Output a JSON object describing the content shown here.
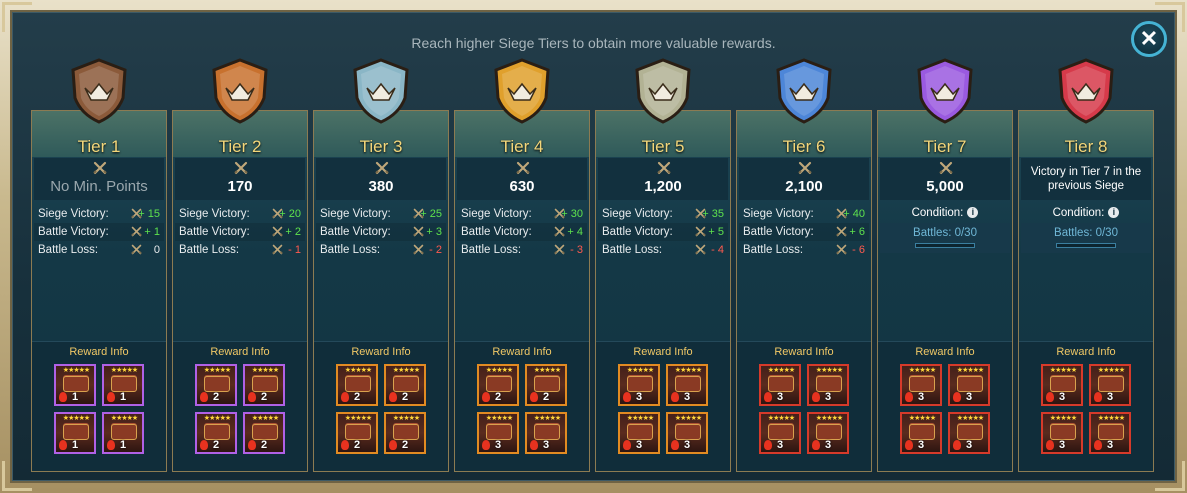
{
  "header": {
    "subtitle": "Reach higher Siege Tiers to obtain more valuable rewards."
  },
  "labels": {
    "siege_victory": "Siege Victory:",
    "battle_victory": "Battle Victory:",
    "battle_loss": "Battle Loss:",
    "reward_info": "Reward Info",
    "condition": "Condition:",
    "info_icon": "i",
    "close_icon": "✕"
  },
  "tiers": [
    {
      "name": "Tier 1",
      "points": "No Min. Points",
      "siege": "+ 15",
      "victory": "+ 1",
      "loss": "0",
      "lossType": "zero",
      "chestColor": "purple",
      "qty": [
        "1",
        "1",
        "1",
        "1"
      ],
      "shieldColor": "#8b5a3a"
    },
    {
      "name": "Tier 2",
      "points": "170",
      "siege": "+ 20",
      "victory": "+ 2",
      "loss": "- 1",
      "lossType": "neg",
      "chestColor": "purple",
      "qty": [
        "2",
        "2",
        "2",
        "2"
      ],
      "shieldColor": "#c8712e"
    },
    {
      "name": "Tier 3",
      "points": "380",
      "siege": "+ 25",
      "victory": "+ 3",
      "loss": "- 2",
      "lossType": "neg",
      "chestColor": "orange",
      "qty": [
        "2",
        "2",
        "2",
        "2"
      ],
      "shieldColor": "#8ab6c6"
    },
    {
      "name": "Tier 4",
      "points": "630",
      "siege": "+ 30",
      "victory": "+ 4",
      "loss": "- 3",
      "lossType": "neg",
      "chestColor": "orange",
      "qty": [
        "2",
        "2",
        "3",
        "3"
      ],
      "shieldColor": "#e0a02c"
    },
    {
      "name": "Tier 5",
      "points": "1,200",
      "siege": "+ 35",
      "victory": "+ 5",
      "loss": "- 4",
      "lossType": "neg",
      "chestColor": "orange",
      "qty": [
        "3",
        "3",
        "3",
        "3"
      ],
      "shieldColor": "#b2b294"
    },
    {
      "name": "Tier 6",
      "points": "2,100",
      "siege": "+ 40",
      "victory": "+ 6",
      "loss": "- 6",
      "lossType": "neg",
      "chestColor": "red",
      "qty": [
        "3",
        "3",
        "3",
        "3"
      ],
      "shieldColor": "#4d86d8"
    },
    {
      "name": "Tier 7",
      "points": "5,000",
      "condition": "Condition:",
      "battles": "Battles: 0/30",
      "chestColor": "red",
      "qty": [
        "3",
        "3",
        "3",
        "3"
      ],
      "shieldColor": "#9a5ae0"
    },
    {
      "name": "Tier 8",
      "points_text": "Victory in Tier 7 in the previous Siege",
      "condition": "Condition:",
      "battles": "Battles: 0/30",
      "chestColor": "red",
      "qty": [
        "3",
        "3",
        "3",
        "3"
      ],
      "shieldColor": "#d63a4a"
    }
  ]
}
